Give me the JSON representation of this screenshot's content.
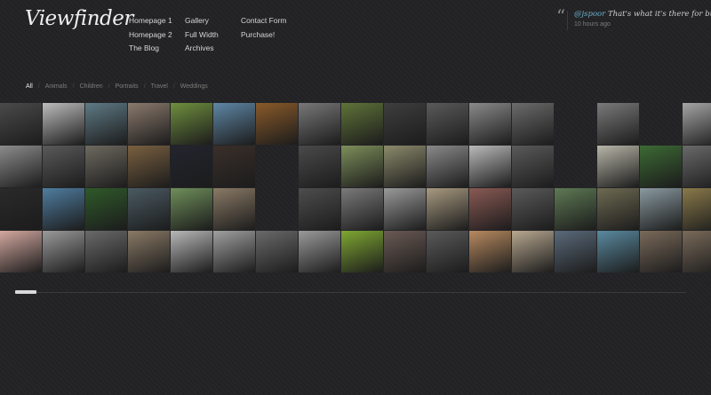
{
  "brand": {
    "name": "Viewfinder"
  },
  "nav": {
    "col1": [
      "Homepage 1",
      "Homepage 2",
      "The Blog"
    ],
    "col2": [
      "Gallery",
      "Full Width",
      "Archives"
    ],
    "col3": [
      "Contact Form",
      "Purchase!"
    ]
  },
  "tweet": {
    "user": "@jspoor",
    "text": " That's what it's there for bud!",
    "time": "10 hours ago"
  },
  "filters": [
    "All",
    "Animals",
    "Children",
    "Portraits",
    "Travel",
    "Weddings"
  ],
  "filter_active": "All",
  "gallery": {
    "rows": [
      [
        "#4a4a4a",
        "#bdbdbd",
        "#5f7a86",
        "#8b7a6d",
        "#6f8f3e",
        "#5f87a6",
        "#8a5a2a",
        "#787878",
        "#5f7339",
        "#3e3e3e",
        "#5a5a5a",
        "#8a8a8a",
        "#6b6b6b",
        "",
        "#7a7a7a",
        "",
        "#a5a5a5"
      ],
      [
        "#8c8c8c",
        "#5a5a5a",
        "#6e6a60",
        "#7a6040",
        "#22252e",
        "#3a2f2a",
        "",
        "#4a4a4a",
        "#7d8f5a",
        "#8c8a6c",
        "#8a8a8a",
        "#bababa",
        "#5a5a5a",
        "",
        "#b8b6a8",
        "#3c6a34",
        "#6a6a6a"
      ],
      [
        "#2a2a2a",
        "#4f7da0",
        "#2f5a2a",
        "#4a5a62",
        "#6f8f5a",
        "#8a7a66",
        "",
        "#4d4d4d",
        "#7a7a7a",
        "#9a9a9a",
        "#a89a80",
        "#8a5a54",
        "#5a5a5a",
        "#5e7a54",
        "#6e6a52",
        "#8a9aa0",
        "#8a7a4a"
      ],
      [
        "#d4a8a0",
        "#9a9a9a",
        "#6a6a6a",
        "#8a7a66",
        "#b8b8b8",
        "#a0a0a0",
        "#6a6a6a",
        "#9a9a9a",
        "#7fa832",
        "#6a5a54",
        "#5a5a5a",
        "#b88a60",
        "#b8a890",
        "#5a6a7a",
        "#5a8aa0",
        "#7a6a5a",
        "#7a6a5a"
      ]
    ]
  }
}
